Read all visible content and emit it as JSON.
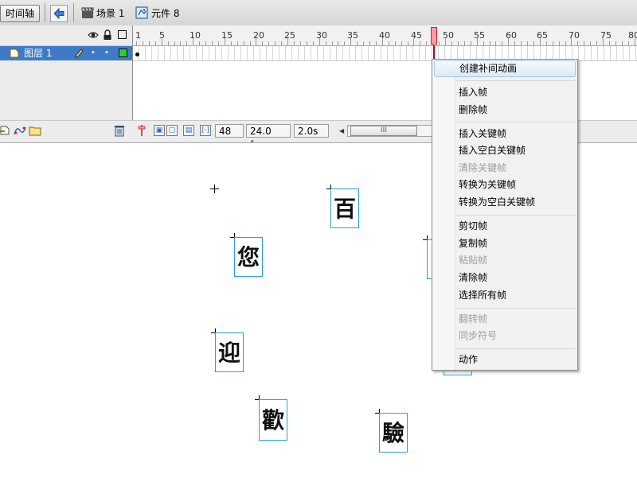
{
  "topbar": {
    "timeline_tab": "时间轴",
    "scene_label": "场景 1",
    "symbol_label": "元件 8"
  },
  "timeline": {
    "ruler_labels": [
      "1",
      "5",
      "10",
      "15",
      "20",
      "25",
      "30",
      "35",
      "40",
      "45",
      "50",
      "55",
      "60",
      "65",
      "70",
      "75",
      "80"
    ],
    "current_frame": "48",
    "layer_name": "图层 1",
    "frame_field": "48",
    "fps_field": "24.0 fps",
    "time_field": "2.0s",
    "scroll_grip": "III"
  },
  "stage": {
    "glyphs": [
      "百",
      "您",
      "迎",
      "歡",
      "驗"
    ]
  },
  "context_menu": {
    "items": [
      {
        "label": "创建补间动画",
        "enabled": true
      },
      {
        "label": "插入帧",
        "enabled": true
      },
      {
        "label": "删除帧",
        "enabled": true
      },
      {
        "label": "插入关键帧",
        "enabled": true
      },
      {
        "label": "插入空白关键帧",
        "enabled": true
      },
      {
        "label": "清除关键帧",
        "enabled": false
      },
      {
        "label": "转换为关键帧",
        "enabled": true
      },
      {
        "label": "转换为空白关键帧",
        "enabled": true
      },
      {
        "label": "剪切帧",
        "enabled": true
      },
      {
        "label": "复制帧",
        "enabled": true
      },
      {
        "label": "粘贴帧",
        "enabled": false
      },
      {
        "label": "清除帧",
        "enabled": true
      },
      {
        "label": "选择所有帧",
        "enabled": true
      },
      {
        "label": "翻转帧",
        "enabled": false
      },
      {
        "label": "同步符号",
        "enabled": false
      },
      {
        "label": "动作",
        "enabled": true
      }
    ]
  },
  "colors": {
    "layer_selected": "#3f7ac6",
    "playhead": "#ff9aa0",
    "symbol_outline": "#2b9bdc",
    "layer_color_box": "#33cc33"
  }
}
